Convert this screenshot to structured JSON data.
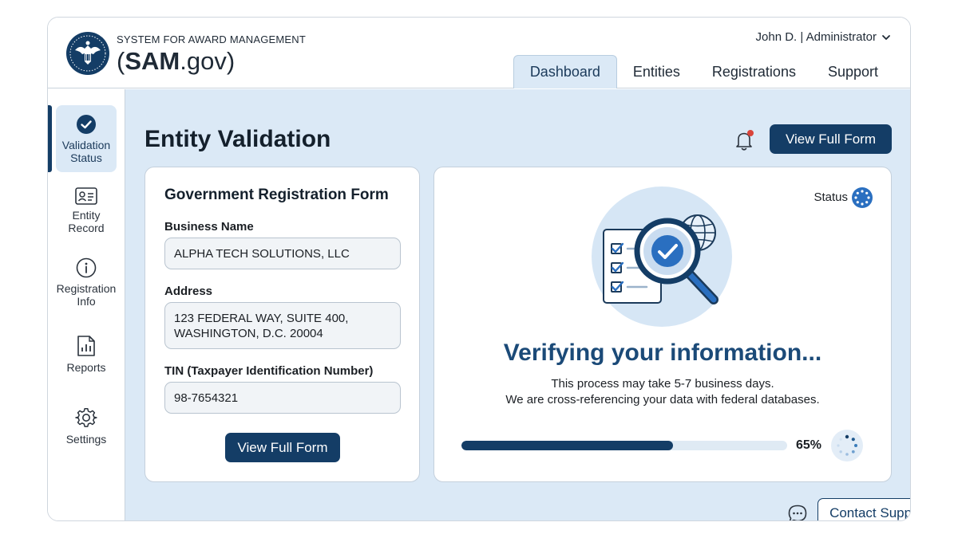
{
  "header": {
    "brand_small": "SYSTEM FOR AWARD MANAGEMENT",
    "brand_open": "(",
    "brand_bold": "SAM",
    "brand_rest": ".gov)",
    "user_label": "John D. | Administrator"
  },
  "nav": {
    "tabs": [
      {
        "label": "Dashboard",
        "active": true
      },
      {
        "label": "Entities",
        "active": false
      },
      {
        "label": "Registrations",
        "active": false
      },
      {
        "label": "Support",
        "active": false
      }
    ]
  },
  "sidebar": {
    "items": [
      {
        "line1": "Validation",
        "line2": "Status",
        "icon": "check-circle-icon",
        "active": true
      },
      {
        "line1": "Entity",
        "line2": "Record",
        "icon": "id-card-icon",
        "active": false
      },
      {
        "line1": "Registration",
        "line2": "Info",
        "icon": "info-icon",
        "active": false
      },
      {
        "line1": "Reports",
        "line2": "",
        "icon": "report-icon",
        "active": false
      },
      {
        "line1": "Settings",
        "line2": "",
        "icon": "gear-icon",
        "active": false
      }
    ]
  },
  "main": {
    "title": "Entity Validation",
    "top_button": "View Full Form",
    "contact_button": "Contact Support"
  },
  "form": {
    "title": "Government Registration Form",
    "business_name_label": "Business Name",
    "business_name_value": "ALPHA TECH SOLUTIONS, LLC",
    "address_label": "Address",
    "address_line1": "123 FEDERAL WAY, SUITE 400,",
    "address_line2": "WASHINGTON, D.C. 20004",
    "tin_label": "TIN (Taxpayer Identification Number)",
    "tin_value": "98-7654321",
    "button": "View Full Form"
  },
  "status": {
    "label": "Status",
    "headline": "Verifying your information...",
    "line1": "This process may take 5-7 business days.",
    "line2": "We are cross-referencing your data with federal databases.",
    "progress_percent": 65,
    "progress_text": "65%"
  },
  "colors": {
    "primary": "#143d66",
    "accent_light": "#dbe9f6",
    "headline": "#1b4a78",
    "notification_dot": "#d9443b"
  }
}
